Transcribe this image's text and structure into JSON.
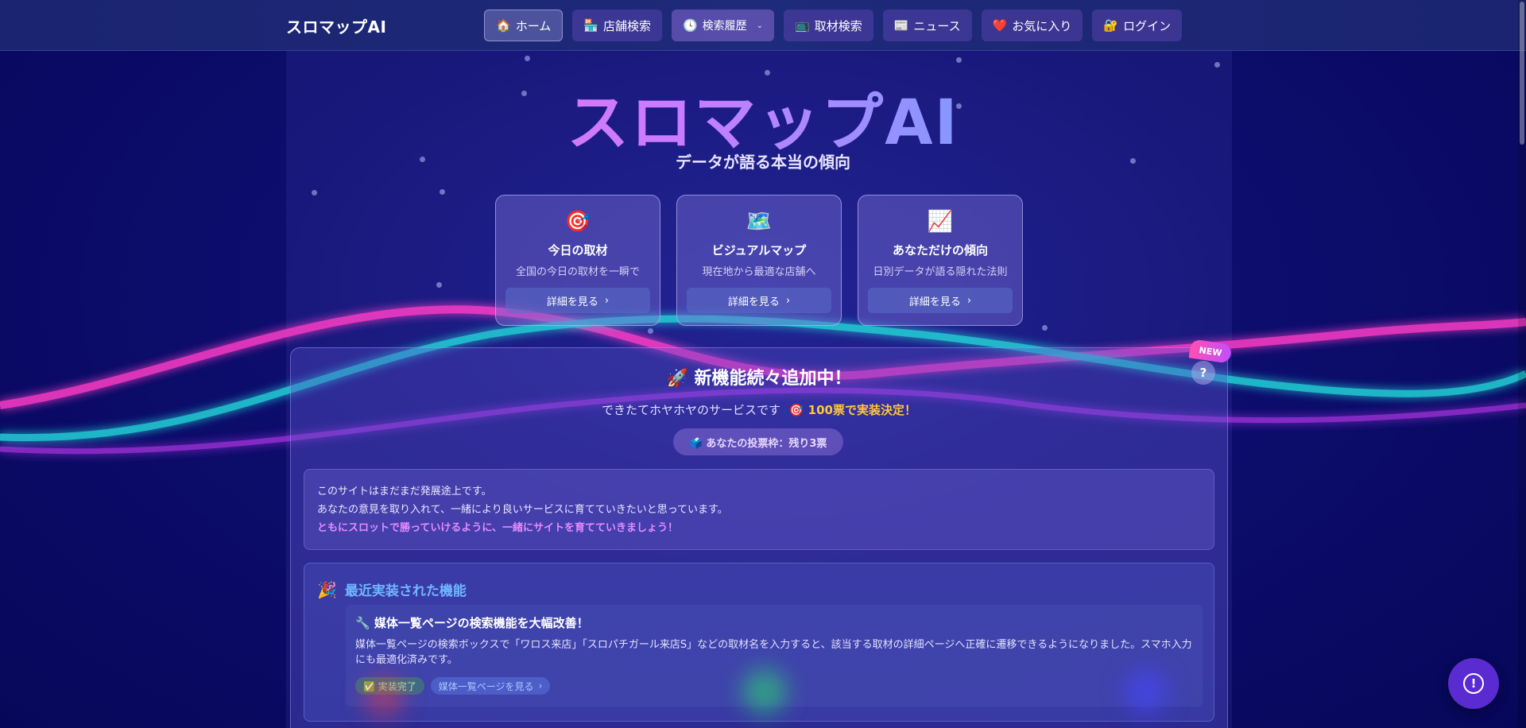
{
  "header": {
    "brand": "スロマップAI",
    "nav": [
      {
        "icon": "🏠",
        "label": "ホーム"
      },
      {
        "icon": "🏪",
        "label": "店舗検索"
      },
      {
        "icon": "🕓",
        "label": "検索履歴"
      },
      {
        "icon": "📺",
        "label": "取材検索"
      },
      {
        "icon": "📰",
        "label": "ニュース"
      },
      {
        "icon": "❤️",
        "label": "お気に入り"
      },
      {
        "icon": "🔐",
        "label": "ログイン"
      }
    ]
  },
  "hero": {
    "title": "スロマップAI",
    "subtitle": "データが語る本当の傾向"
  },
  "cards": [
    {
      "icon": "🎯",
      "title": "今日の取材",
      "desc": "全国の今日の取材を一瞬で",
      "button": "詳細を見る"
    },
    {
      "icon": "🗺️",
      "title": "ビジュアルマップ",
      "desc": "現在地から最適な店舗へ",
      "button": "詳細を見る"
    },
    {
      "icon": "📈",
      "title": "あなただけの傾向",
      "desc": "日別データが語る隠れた法則",
      "button": "詳細を見る"
    }
  ],
  "announcement": {
    "badge": "NEW",
    "help": "?",
    "title": "🚀 新機能続々追加中！",
    "subtitle": "できたてホヤホヤのサービスです",
    "accent": "🎯 100票で実装決定！",
    "vote": "🗳️ あなたの投票枠：残り3票",
    "intro": [
      "このサイトはまだまだ発展途上です。",
      "あなたの意見を取り入れて、一緒により良いサービスに育てていきたいと思っています。",
      "ともにスロットで勝っていけるように、一緒にサイトを育てていきましょう！"
    ]
  },
  "recent": {
    "icon": "🎉",
    "heading": "最近実装された機能",
    "feature": {
      "title": "🔧 媒体一覧ページの検索機能を大幅改善！",
      "desc": "媒体一覧ページの検索ボックスで「ワロス来店」「スロパチガール来店S」などの取材名を入力すると、該当する取材の詳細ページへ正確に遷移できるようになりました。スマホ入力にも最適化済みです。",
      "status": "✅ 実装完了",
      "link": "媒体一覧ページを見る"
    }
  },
  "fab": {
    "icon": "!"
  },
  "colors": {
    "background": "#0d0d6e",
    "accent_pink": "#ff6ad5",
    "accent_blue": "#3fd0ff",
    "accent_yellow": "#ffc53d"
  }
}
